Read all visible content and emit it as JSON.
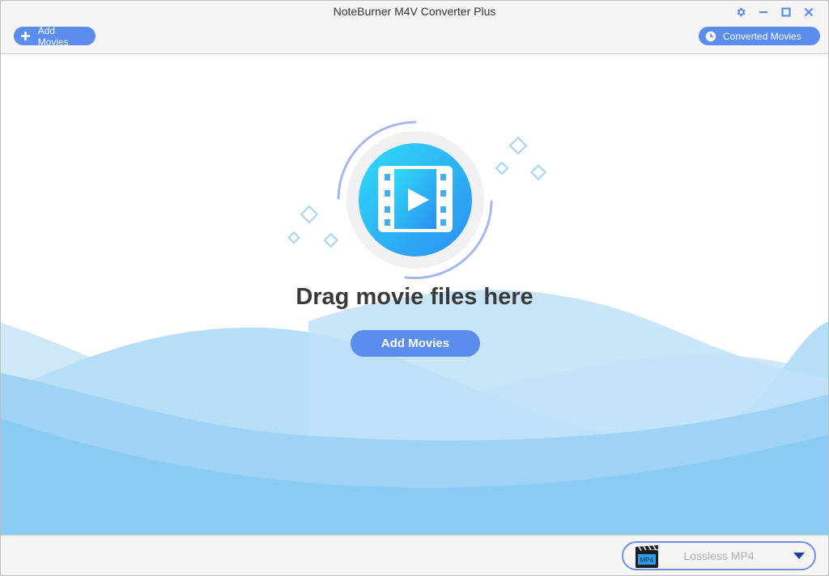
{
  "window": {
    "title": "NoteBurner M4V Converter Plus"
  },
  "toolbar": {
    "add_movies_label": "Add Movies",
    "converted_movies_label": "Converted Movies"
  },
  "main": {
    "drop_text": "Drag movie files here",
    "add_button_label": "Add Movies"
  },
  "footer": {
    "format_badge": "MP4",
    "format_selected": "Lossless MP4"
  },
  "colors": {
    "accent": "#5a8dee",
    "wave_light": "#cfe8f8",
    "wave_mid": "#a9d7f5",
    "wave_deep": "#86c9f3"
  },
  "icons": {
    "settings": "gear-icon",
    "minimize": "minimize-icon",
    "maximize": "maximize-icon",
    "close": "close-icon",
    "add": "plus-icon",
    "history": "clock-icon",
    "video": "video-play-icon",
    "dropdown": "chevron-down-icon"
  }
}
